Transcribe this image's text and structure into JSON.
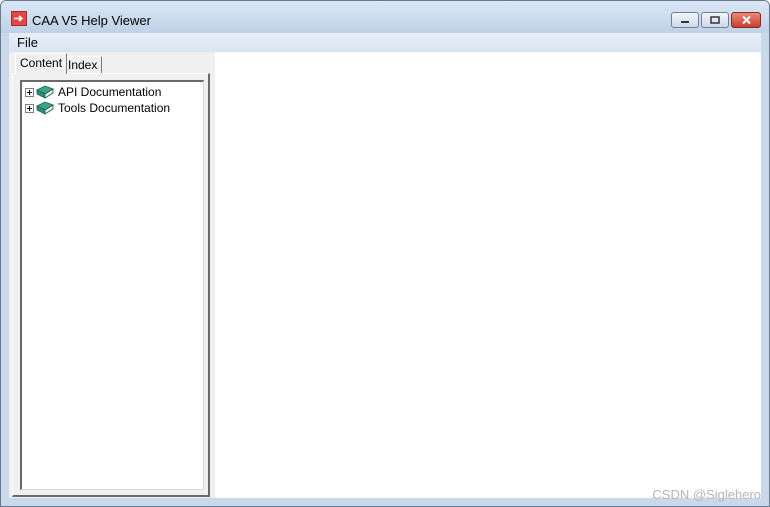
{
  "window": {
    "title": "CAA V5 Help Viewer",
    "icon": "app-icon",
    "buttons": [
      "minimize-icon",
      "restore-icon",
      "close-icon"
    ]
  },
  "menu": {
    "file_label": "File"
  },
  "tabs": [
    {
      "label": "Content",
      "active": true
    },
    {
      "label": "Index",
      "active": false
    }
  ],
  "tree": {
    "items": [
      {
        "label": "API Documentation",
        "icon": "book-icon",
        "expanded": false
      },
      {
        "label": "Tools Documentation",
        "icon": "book-icon",
        "expanded": false
      }
    ]
  },
  "watermark": "CSDN @Siglehero",
  "colors": {
    "titlebar": "#bfd1e8",
    "close_button": "#c8402c",
    "book": "#2f8f7a"
  }
}
